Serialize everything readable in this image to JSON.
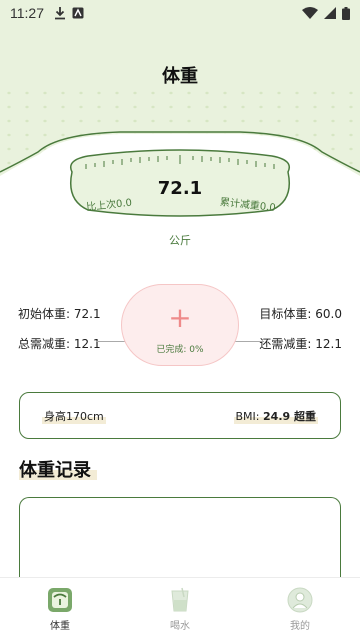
{
  "status_bar": {
    "time": "11:27",
    "icons_left": [
      "download-icon",
      "app-notification-icon"
    ],
    "icons_right": [
      "wifi-icon",
      "signal-icon",
      "battery-icon"
    ]
  },
  "header": {
    "title": "体重"
  },
  "scale": {
    "weight": "72.1",
    "compare_last": "比上次0.0",
    "cumulative_loss": "累计减重0.0",
    "unit": "公斤"
  },
  "stats": {
    "initial_weight": "初始体重: 72.1",
    "target_weight": "目标体重: 60.0",
    "total_to_lose": "总需减重: 12.1",
    "remaining_to_lose": "还需减重: 12.1",
    "completed": "已完成: 0%"
  },
  "info_card": {
    "height": "身高170cm",
    "bmi_label": "BMI:",
    "bmi_value": "24.9 超重"
  },
  "records": {
    "title": "体重记录"
  },
  "tabbar": {
    "tabs": [
      {
        "label": "体重",
        "icon": "scale-icon",
        "active": true
      },
      {
        "label": "喝水",
        "icon": "water-cup-icon",
        "active": false
      },
      {
        "label": "我的",
        "icon": "profile-icon",
        "active": false
      }
    ]
  },
  "colors": {
    "header_bg": "#e9f2dd",
    "accent_green": "#4a7a3d",
    "add_pink": "#fdeded",
    "plus_pink": "#ef8a8a",
    "highlight": "#f3ecd6"
  }
}
